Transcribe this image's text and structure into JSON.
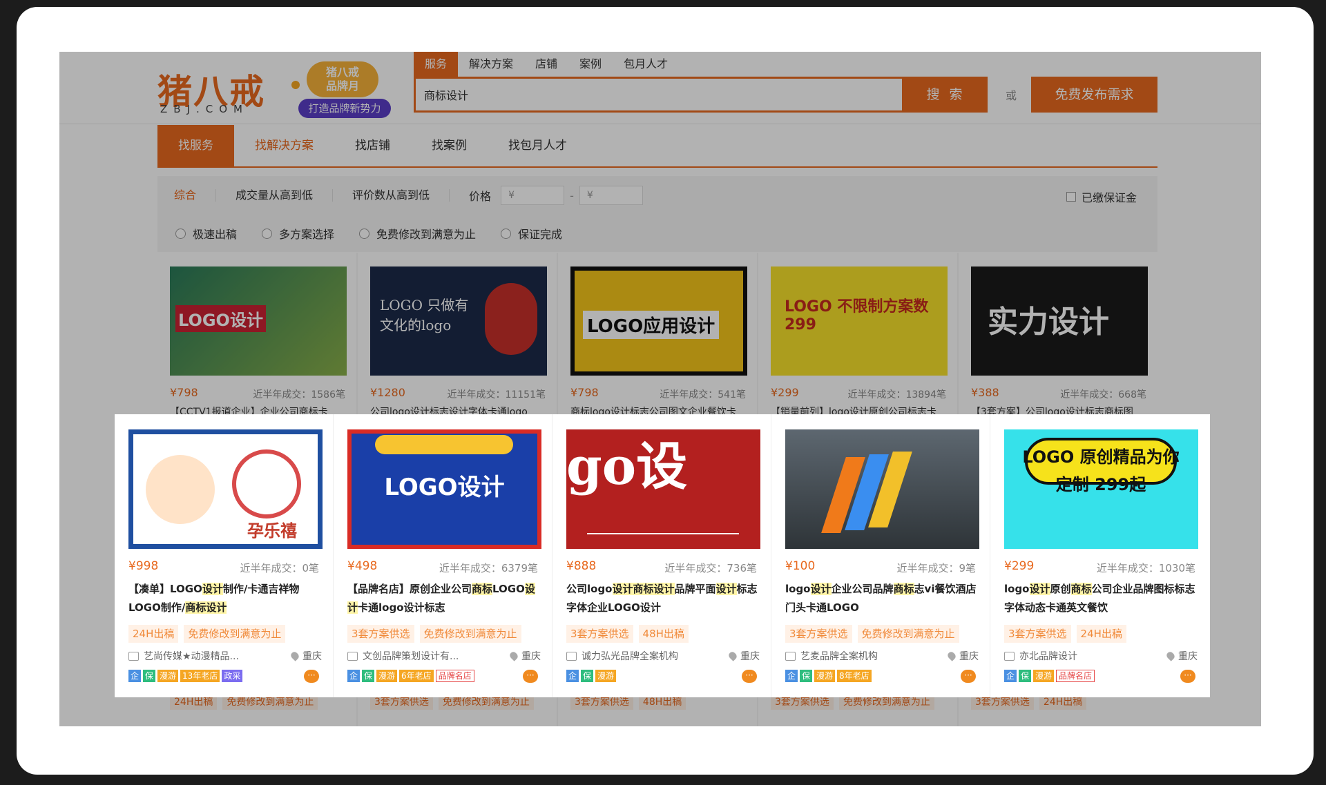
{
  "header": {
    "logo_text": "猪八戒",
    "logo_sub": "ZBJ.COM",
    "promo_line1": "猪八戒",
    "promo_line2": "品牌月",
    "promo_button": "打造品牌新势力",
    "search_tabs": [
      "服务",
      "解决方案",
      "店铺",
      "案例",
      "包月人才"
    ],
    "search_value": "商标设计",
    "search_button": "搜 索",
    "or_text": "或",
    "publish_button": "免费发布需求"
  },
  "nav": {
    "items": [
      "找服务",
      "找解决方案",
      "找店铺",
      "找案例",
      "找包月人才"
    ]
  },
  "filters": {
    "sort": [
      "综合",
      "成交量从高到低",
      "评价数从高到低"
    ],
    "price_label": "价格",
    "price_min_placeholder": "¥",
    "price_sep": "-",
    "price_max_placeholder": "¥",
    "deposit_label": "已缴保证金",
    "options": [
      "极速出稿",
      "多方案选择",
      "免费修改到满意为止",
      "保证完成"
    ]
  },
  "background_cards": [
    {
      "price": "¥798",
      "sales": "近半年成交：1586笔",
      "title": "【CCTV1报道企业】企业公司商标卡",
      "tags": [
        "24H出稿",
        "免费修改到满意为止"
      ],
      "image_text": "LOGO设计"
    },
    {
      "price": "¥1280",
      "sales": "近半年成交：11151笔",
      "title": "公司logo设计标志设计字体卡通logo",
      "tags": [
        "3套方案供选",
        "免费修改到满意为止"
      ],
      "image_text": "LOGO 只做有文化的logo"
    },
    {
      "price": "¥798",
      "sales": "近半年成交：541笔",
      "title": "商标logo设计标志公司图文企业餐饮卡",
      "tags": [
        "3套方案供选",
        "48H出稿"
      ],
      "image_text": "LOGO应用设计"
    },
    {
      "price": "¥299",
      "sales": "近半年成交：13894笔",
      "title": "【销量前列】logo设计原创公司标志卡",
      "tags": [
        "3套方案供选",
        "免费修改到满意为止"
      ],
      "image_text": "LOGO 不限制方案数 299"
    },
    {
      "price": "¥388",
      "sales": "近半年成交：668笔",
      "title": "【3套方案】公司logo设计标志商标图",
      "tags": [
        "3套方案供选",
        "24H出稿"
      ],
      "image_text": "实力设计"
    }
  ],
  "cards": [
    {
      "price": "¥998",
      "sales": "近半年成交：0笔",
      "title_parts": [
        "【凑单】LOGO",
        "设计",
        "制作/卡通吉祥物LOGO制作/",
        "商标设计",
        ""
      ],
      "tags": [
        "24H出稿",
        "免费修改到满意为止"
      ],
      "shop": "艺尚传媒★动漫精品...",
      "location": "重庆",
      "badges": [
        "企",
        "保",
        "漫游",
        "13年老店",
        "政采"
      ],
      "image_text": "孕乐禧"
    },
    {
      "price": "¥498",
      "sales": "近半年成交：6379笔",
      "title_parts": [
        "【品牌名店】原创企业公司",
        "商标",
        "LOGO",
        "设计",
        "卡通logo设计标志"
      ],
      "tags": [
        "3套方案供选",
        "免费修改到满意为止"
      ],
      "shop": "文创品牌策划设计有...",
      "location": "重庆",
      "badges": [
        "企",
        "保",
        "漫游",
        "6年老店",
        "品牌名店"
      ],
      "image_text": "LOGO设计"
    },
    {
      "price": "¥888",
      "sales": "近半年成交：736笔",
      "title_parts": [
        "公司logo",
        "设计商标设计",
        "品牌平面",
        "设计",
        "标志字体企业LOGO设计"
      ],
      "tags": [
        "3套方案供选",
        "48H出稿"
      ],
      "shop": "诚力弘光品牌全案机构",
      "location": "重庆",
      "badges": [
        "企",
        "保",
        "漫游"
      ],
      "image_text": "go设"
    },
    {
      "price": "¥100",
      "sales": "近半年成交：9笔",
      "title_parts": [
        "logo",
        "设计",
        "企业公司品牌",
        "商标",
        "志vi餐饮酒店门头卡通LOGO"
      ],
      "tags": [
        "3套方案供选",
        "免费修改到满意为止"
      ],
      "shop": "艺麦品牌全案机构",
      "location": "重庆",
      "badges": [
        "企",
        "保",
        "漫游",
        "8年老店"
      ],
      "image_text": ""
    },
    {
      "price": "¥299",
      "sales": "近半年成交：1030笔",
      "title_parts": [
        "logo",
        "设计",
        "原创",
        "商标",
        "公司企业品牌图标标志字体动态卡通英文餐饮"
      ],
      "tags": [
        "3套方案供选",
        "24H出稿"
      ],
      "shop": "亦北品牌设计",
      "location": "重庆",
      "badges": [
        "企",
        "保",
        "漫游",
        "品牌名店"
      ],
      "image_text": "LOGO 原创精品为你定制 299起"
    }
  ]
}
